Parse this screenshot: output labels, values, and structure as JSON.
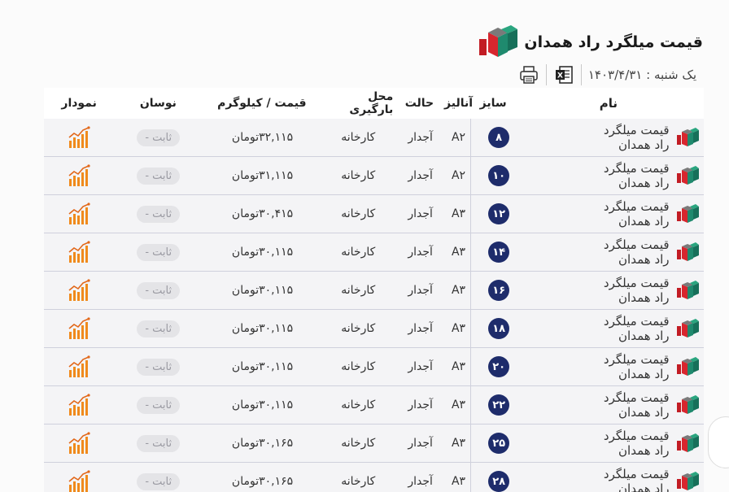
{
  "header": {
    "title": "قیمت میلگرد راد همدان",
    "date": "یک شنبه : ۱۴۰۳/۴/۳۱"
  },
  "toolbar": {
    "excel_icon": "excel-icon",
    "print_icon": "printer-icon"
  },
  "columns": {
    "name": "نام",
    "size": "سایز",
    "analyze": "آنالیز",
    "state": "حالت",
    "place": "محل بارگیری",
    "price": "قیمت / کیلوگرم",
    "trend": "نوسان",
    "chart": "نمودار"
  },
  "rows": [
    {
      "name": "قیمت میلگرد راد همدان",
      "size": "۸",
      "analyze": "A۲",
      "state": "آجدار",
      "place": "کارخانه",
      "price": "۳۲,۱۱۵تومان",
      "trend": "ثابت -"
    },
    {
      "name": "قیمت میلگرد راد همدان",
      "size": "۱۰",
      "analyze": "A۲",
      "state": "آجدار",
      "place": "کارخانه",
      "price": "۳۱,۱۱۵تومان",
      "trend": "ثابت -"
    },
    {
      "name": "قیمت میلگرد راد همدان",
      "size": "۱۲",
      "analyze": "A۳",
      "state": "آجدار",
      "place": "کارخانه",
      "price": "۳۰,۴۱۵تومان",
      "trend": "ثابت -"
    },
    {
      "name": "قیمت میلگرد راد همدان",
      "size": "۱۴",
      "analyze": "A۳",
      "state": "آجدار",
      "place": "کارخانه",
      "price": "۳۰,۱۱۵تومان",
      "trend": "ثابت -"
    },
    {
      "name": "قیمت میلگرد راد همدان",
      "size": "۱۶",
      "analyze": "A۳",
      "state": "آجدار",
      "place": "کارخانه",
      "price": "۳۰,۱۱۵تومان",
      "trend": "ثابت -"
    },
    {
      "name": "قیمت میلگرد راد همدان",
      "size": "۱۸",
      "analyze": "A۳",
      "state": "آجدار",
      "place": "کارخانه",
      "price": "۳۰,۱۱۵تومان",
      "trend": "ثابت -"
    },
    {
      "name": "قیمت میلگرد راد همدان",
      "size": "۲۰",
      "analyze": "A۳",
      "state": "آجدار",
      "place": "کارخانه",
      "price": "۳۰,۱۱۵تومان",
      "trend": "ثابت -"
    },
    {
      "name": "قیمت میلگرد راد همدان",
      "size": "۲۲",
      "analyze": "A۳",
      "state": "آجدار",
      "place": "کارخانه",
      "price": "۳۰,۱۱۵تومان",
      "trend": "ثابت -"
    },
    {
      "name": "قیمت میلگرد راد همدان",
      "size": "۲۵",
      "analyze": "A۳",
      "state": "آجدار",
      "place": "کارخانه",
      "price": "۳۰,۱۶۵تومان",
      "trend": "ثابت -"
    },
    {
      "name": "قیمت میلگرد راد همدان",
      "size": "۲۸",
      "analyze": "A۳",
      "state": "آجدار",
      "place": "کارخانه",
      "price": "۳۰,۱۶۵تومان",
      "trend": "ثابت -"
    }
  ],
  "colors": {
    "badge": "#1e2c6b",
    "brand_green": "#1f8a6e",
    "brand_red": "#d7262e",
    "chart_orange": "#f08a1c"
  }
}
